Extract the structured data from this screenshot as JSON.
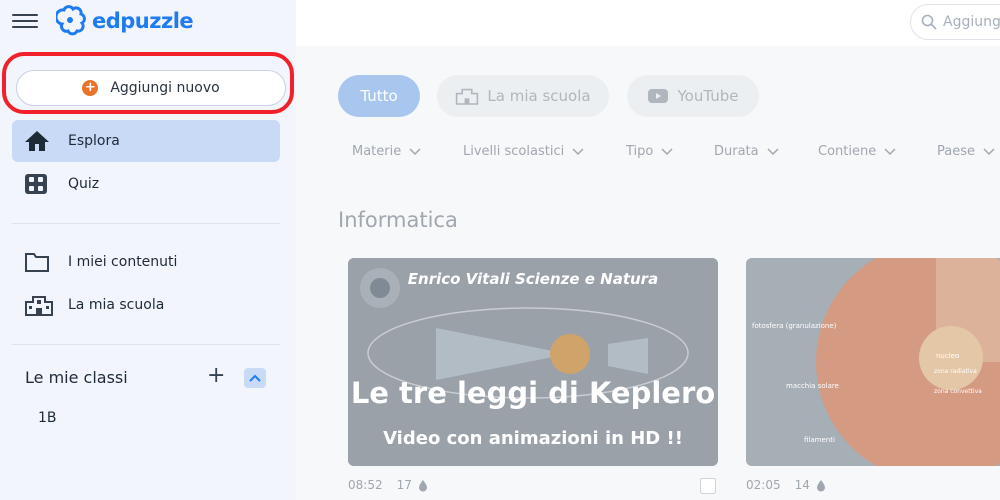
{
  "brand": {
    "name": "edpuzzle"
  },
  "sidebar": {
    "add_button": "Aggiungi nuovo",
    "nav": [
      {
        "label": "Esplora",
        "icon": "home-icon",
        "active": true
      },
      {
        "label": "Quiz",
        "icon": "quiz-icon",
        "active": false
      }
    ],
    "content_nav": [
      {
        "label": "I miei contenuti",
        "icon": "folder-icon"
      },
      {
        "label": "La mia scuola",
        "icon": "school-icon"
      }
    ],
    "classes_title": "Le mie classi",
    "classes": [
      "1B"
    ]
  },
  "search": {
    "placeholder": "Aggiungi"
  },
  "tabs": [
    {
      "label": "Tutto",
      "active": true
    },
    {
      "label": "La mia scuola",
      "icon": "school-icon",
      "active": false
    },
    {
      "label": "YouTube",
      "icon": "youtube-icon",
      "active": false
    }
  ],
  "filters": [
    "Materie",
    "Livelli scolastici",
    "Tipo",
    "Durata",
    "Contiene",
    "Paese"
  ],
  "section": {
    "title": "Informatica"
  },
  "videos": [
    {
      "channel": "Enrico Vitali Scienze e Natura",
      "title": "Le tre leggi di Keplero",
      "subtitle": "Video con animazioni in HD !!",
      "duration": "08:52",
      "questions": "17"
    },
    {
      "labels": [
        "fotosfera (granulazione)",
        "nucleo",
        "zona radiativa",
        "zona convettiva",
        "macchia solare",
        "filamenti"
      ],
      "duration": "02:05",
      "questions": "14"
    }
  ],
  "colors": {
    "brand_blue": "#1e7bf0",
    "highlight_red": "#f2202a",
    "active_bg": "#c8daf6",
    "add_orange": "#e8742c"
  }
}
